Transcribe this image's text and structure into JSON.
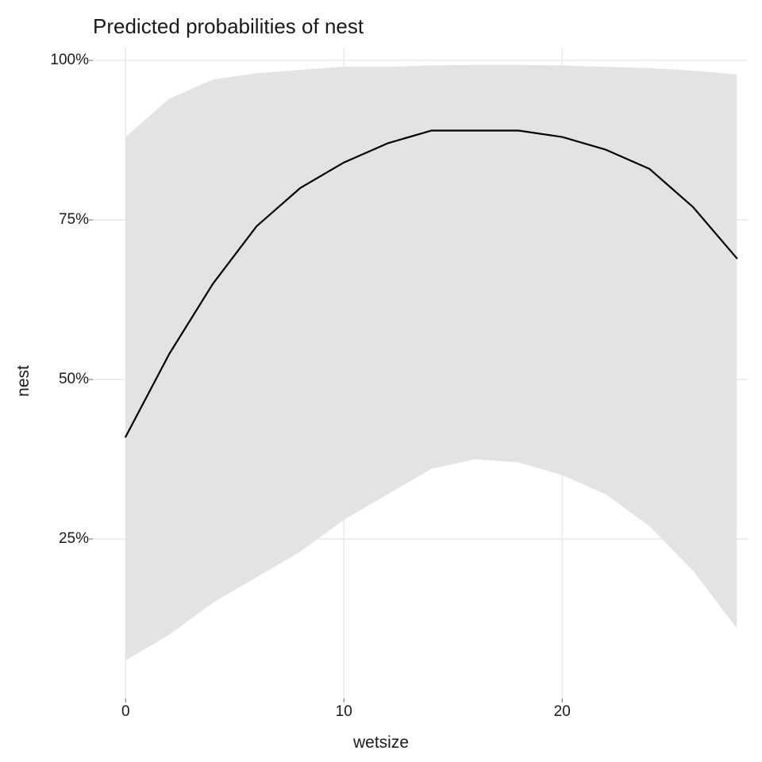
{
  "chart_data": {
    "type": "line",
    "title": "Predicted probabilities of nest",
    "xlabel": "wetsize",
    "ylabel": "nest",
    "xlim": [
      -1.5,
      28.5
    ],
    "ylim": [
      0,
      102
    ],
    "x_ticks": [
      0,
      10,
      20
    ],
    "y_ticks": [
      25,
      50,
      75,
      100
    ],
    "y_tick_labels": [
      "25%",
      "50%",
      "75%",
      "100%"
    ],
    "x": [
      0,
      2,
      4,
      6,
      8,
      10,
      12,
      14,
      16,
      18,
      20,
      22,
      24,
      26,
      28
    ],
    "line": [
      41,
      54,
      65,
      74,
      80,
      84,
      87,
      89,
      89,
      89,
      88,
      86,
      83,
      77,
      69
    ],
    "upper": [
      88,
      94,
      97,
      98,
      98.5,
      99,
      99,
      99.2,
      99.3,
      99.3,
      99.2,
      99,
      98.8,
      98.4,
      97.8
    ],
    "lower": [
      6,
      10,
      15,
      19,
      23,
      28,
      32,
      36,
      37.5,
      37,
      35,
      32,
      27,
      20,
      11
    ]
  }
}
